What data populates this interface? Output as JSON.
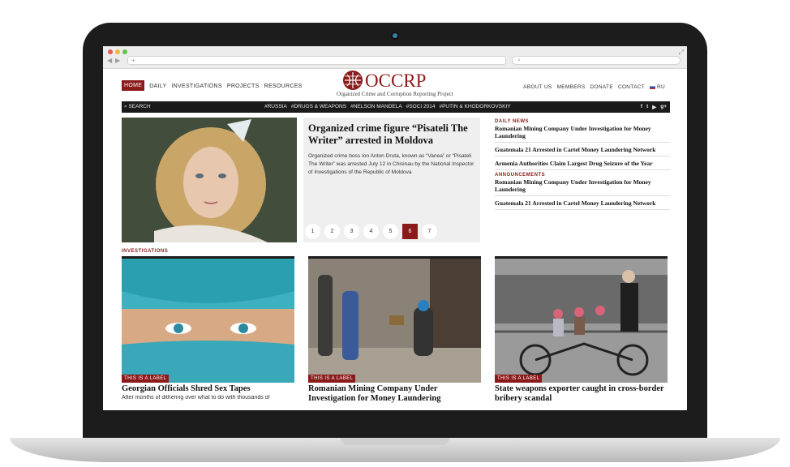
{
  "site": {
    "logo_text": "OCCRP",
    "logo_subtitle": "Organized Crime and Corruption Reporting Project",
    "brand_color": "#8b1a1a"
  },
  "main_nav": [
    "HOME",
    "DAILY",
    "INVESTIGATIONS",
    "PROJECTS",
    "RESOURCES"
  ],
  "right_nav": [
    "ABOUT US",
    "MEMBERS",
    "DONATE",
    "CONTACT",
    "RU"
  ],
  "search_label": "SEARCH",
  "tags": [
    "#RUSSIA",
    "#DRUGS & WEAPONS",
    "#NELSON MANDELA",
    "#SOCI 2014",
    "#PUTIN & KHODORKOVSKIY"
  ],
  "social_icons": [
    "facebook-icon",
    "twitter-icon",
    "youtube-icon",
    "googleplus-icon"
  ],
  "social": [
    "f",
    "t",
    "▶",
    "g+"
  ],
  "browser": {
    "new_tab": "+"
  },
  "hero": {
    "title": "Organized crime figure “Pisateli The Writer” arrested in Moldova",
    "text": "Organized crime boss Ion Anton Druta, known as “Vanea” or “Pisateli The Writer” was arrested July 12 in Chisinau by the National Inspector of Investigations of the Republic of Moldova",
    "pages": [
      "1",
      "2",
      "3",
      "4",
      "5",
      "6",
      "7"
    ],
    "active_page": "6"
  },
  "sidebar": {
    "daily_label": "DAILY NEWS",
    "daily": [
      "Romanian Mining Company Under Investigation for Money Laundering",
      "Guatemala 21 Arrested in Cartel Money Laundering Network",
      "Armenia Authorities Claim Largest Drug Seizure of the Year"
    ],
    "ann_label": "ANNOUNCEMENTS",
    "announcements": [
      "Romanian Mining Company Under Investigation for Money Laundering",
      "Guatemala 21 Arrested in Cartel Money Laundering Network"
    ]
  },
  "investigations_label": "INVESTIGATIONS",
  "cards": [
    {
      "tag": "THIS IS A LABEL",
      "title": "Georgian Officials Shred Sex Tapes",
      "text": "After months of dithering over what to do with thousands of"
    },
    {
      "tag": "THIS IS A LABEL",
      "title": "Romanian Mining Company Under Investigation for Money Laundering",
      "text": ""
    },
    {
      "tag": "THIS IS A LABEL",
      "title": "State weapons exporter caught in cross-border bribery scandal",
      "text": ""
    }
  ]
}
